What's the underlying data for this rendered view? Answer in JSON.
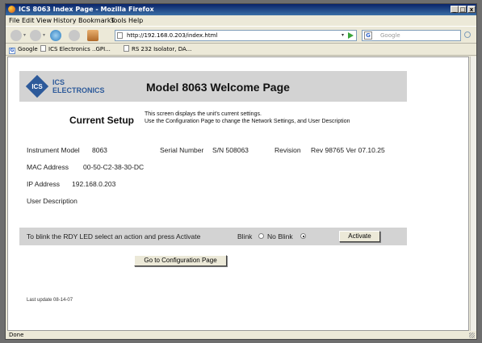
{
  "window": {
    "title": "ICS 8063 Index Page - Mozilla Firefox",
    "controls": [
      "_",
      "□",
      "x"
    ]
  },
  "menu": [
    "File",
    "Edit",
    "View",
    "History",
    "Bookmarks",
    "Tools",
    "Help"
  ],
  "nav": {
    "url": "http://192.168.0.203/index.html",
    "search_placeholder": "Google",
    "icons": [
      "back-icon",
      "forward-icon",
      "reload-icon",
      "stop-icon",
      "home-icon"
    ]
  },
  "bookmarks": [
    "Google",
    "ICS Electronics ..GPI...",
    "RS 232 Isolator, DA..."
  ],
  "page": {
    "logo_text": "ICS",
    "brand_line1": "ICS",
    "brand_line2": "ELECTRONICS",
    "title": "Model 8063 Welcome Page",
    "current_setup_title": "Current Setup",
    "current_setup_desc1": "This screen displays the unit's current settings.",
    "current_setup_desc2": "Use the Configuration Page to change the Network Settings, and User Description",
    "instrument_model_label": "Instrument Model",
    "instrument_model_value": "8063",
    "serial_number_label": "Serial Number",
    "serial_number_value": "S/N 508063",
    "revision_label": "Revision",
    "revision_value": "Rev 98765 Ver 07.10.25",
    "mac_label": "MAC Address",
    "mac_value": "00-50-C2-38-30-DC",
    "ip_label": "IP Address",
    "ip_value": "192.168.0.203",
    "user_desc_label": "User Description",
    "blink_text": "To blink the RDY LED select an action and press Activate",
    "blink_option": "Blink",
    "noblink_option": "No Blink",
    "selected_option": "No Blink",
    "activate_button": "Activate",
    "config_button": "Go to Configuration Page",
    "last_update": "Last update 08-14-07"
  },
  "status": {
    "text": "Done"
  },
  "colors": {
    "brand_blue": "#2d5a9a",
    "header_gray": "#d3d3d3",
    "titlebar": "#0a246a"
  }
}
